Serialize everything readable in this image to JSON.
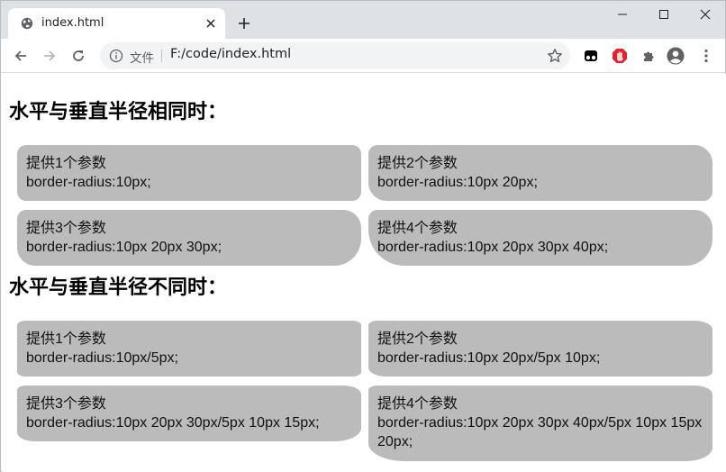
{
  "browser": {
    "tab_title": "index.html",
    "scheme_label": "文件",
    "url": "F:/code/index.html"
  },
  "sections": [
    {
      "title": "水平与垂直半径相同时：",
      "boxes": [
        {
          "label": "提供1个参数",
          "code": "border-radius:10px;"
        },
        {
          "label": "提供2个参数",
          "code": "border-radius:10px 20px;"
        },
        {
          "label": "提供3个参数",
          "code": "border-radius:10px 20px 30px;"
        },
        {
          "label": "提供4个参数",
          "code": "border-radius:10px 20px 30px 40px;"
        }
      ]
    },
    {
      "title": "水平与垂直半径不同时：",
      "boxes": [
        {
          "label": "提供1个参数",
          "code": "border-radius:10px/5px;"
        },
        {
          "label": "提供2个参数",
          "code": "border-radius:10px 20px/5px 10px;"
        },
        {
          "label": "提供3个参数",
          "code": "border-radius:10px 20px 30px/5px 10px 15px;"
        },
        {
          "label": "提供4个参数",
          "code": "border-radius:10px 20px 30px 40px/5px 10px 15px 20px;"
        }
      ]
    }
  ]
}
